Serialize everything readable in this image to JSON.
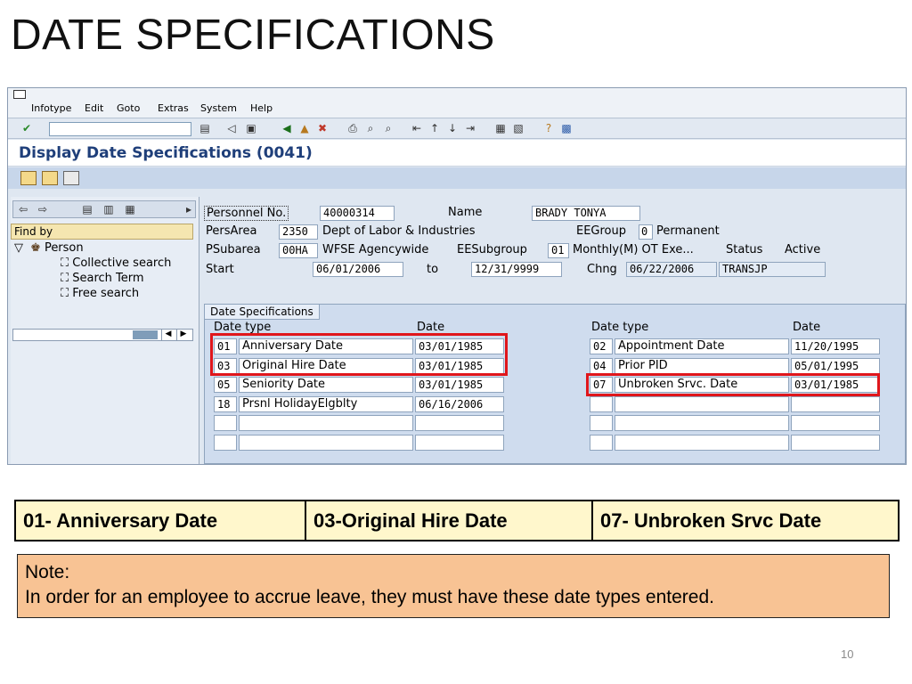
{
  "slide": {
    "title": "DATE SPECIFICATIONS",
    "page_number": "10"
  },
  "sap": {
    "menu": [
      "Infotype",
      "Edit",
      "Goto",
      "Extras",
      "System",
      "Help"
    ],
    "screen_title": "Display Date Specifications (0041)",
    "nav": {
      "find_by": "Find by",
      "tree_root": "Person",
      "tree_items": [
        "Collective search",
        "Search Term",
        "Free search"
      ]
    },
    "header": {
      "persno_label": "Personnel No.",
      "persno_value": "40000314",
      "name_label": "Name",
      "name_value": "BRADY TONYA",
      "persarea_label": "PersArea",
      "persarea_code": "2350",
      "persarea_text": "Dept of Labor & Industries",
      "eegroup_label": "EEGroup",
      "eegroup_code": "0",
      "eegroup_text": "Permanent",
      "psubarea_label": "PSubarea",
      "psubarea_code": "00HA",
      "psubarea_text": "WFSE Agencywide",
      "eesubgroup_label": "EESubgroup",
      "eesubgroup_code": "01",
      "eesubgroup_text": "Monthly(M) OT Exe...",
      "status_label": "Status",
      "status_value": "Active",
      "start_label": "Start",
      "start_value": "06/01/2006",
      "to_label": "to",
      "to_value": "12/31/9999",
      "chng_label": "Chng",
      "chng_date": "06/22/2006",
      "chng_user": "TRANSJP"
    },
    "dates": {
      "tab_label": "Date Specifications",
      "col_type": "Date type",
      "col_date": "Date",
      "left": [
        {
          "code": "01",
          "type": "Anniversary Date",
          "date": "03/01/1985"
        },
        {
          "code": "03",
          "type": "Original Hire Date",
          "date": "03/01/1985"
        },
        {
          "code": "05",
          "type": "Seniority Date",
          "date": "03/01/1985"
        },
        {
          "code": "18",
          "type": "Prsnl HolidayElgblty",
          "date": "06/16/2006"
        },
        {
          "code": "",
          "type": "",
          "date": ""
        },
        {
          "code": "",
          "type": "",
          "date": ""
        }
      ],
      "right": [
        {
          "code": "02",
          "type": "Appointment Date",
          "date": "11/20/1995"
        },
        {
          "code": "04",
          "type": "Prior PID",
          "date": "05/01/1995"
        },
        {
          "code": "07",
          "type": "Unbroken Srvc. Date",
          "date": "03/01/1985"
        },
        {
          "code": "",
          "type": "",
          "date": ""
        },
        {
          "code": "",
          "type": "",
          "date": ""
        },
        {
          "code": "",
          "type": "",
          "date": ""
        }
      ]
    }
  },
  "summary": [
    "01- Anniversary Date",
    "03-Original Hire Date",
    "07- Unbroken Srvc Date"
  ],
  "note": {
    "line1": "Note:",
    "line2": "In order for an employee to accrue leave, they must have these date types entered."
  },
  "colors": {
    "highlight": "#e0161b",
    "summary_bg": "#fff7cc",
    "note_bg": "#f8c394",
    "sap_title": "#1f3f7a"
  }
}
